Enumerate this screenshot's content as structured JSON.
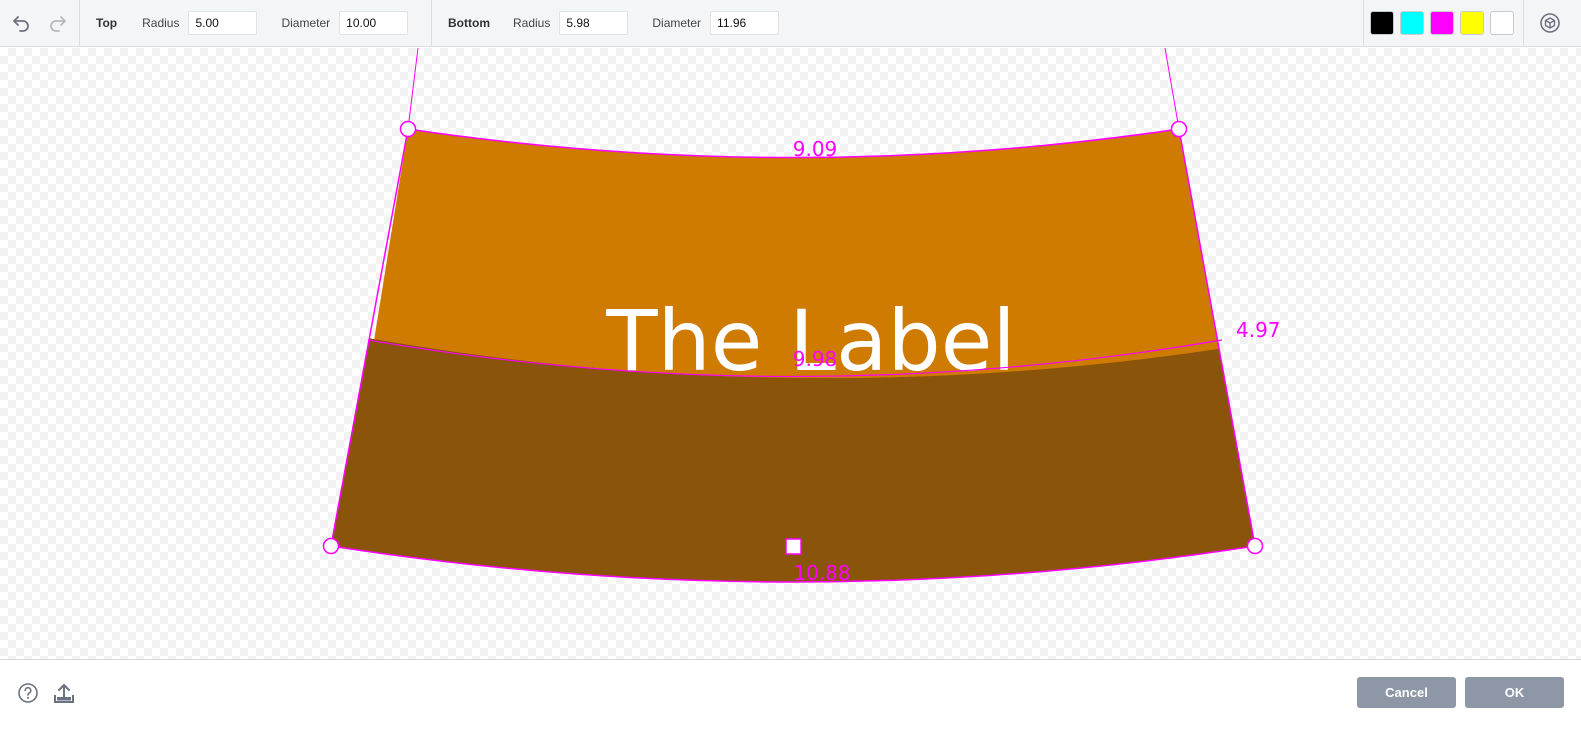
{
  "toolbar": {
    "undo_icon": "undo-icon",
    "redo_icon": "redo-icon",
    "top": {
      "title": "Top",
      "radius_label": "Radius",
      "radius_value": "5.00",
      "diameter_label": "Diameter",
      "diameter_value": "10.00"
    },
    "bottom": {
      "title": "Bottom",
      "radius_label": "Radius",
      "radius_value": "5.98",
      "diameter_label": "Diameter",
      "diameter_value": "11.96"
    },
    "swatches": [
      {
        "name": "black",
        "color": "#000000"
      },
      {
        "name": "cyan",
        "color": "#00ffff"
      },
      {
        "name": "magenta",
        "color": "#ff00ff"
      },
      {
        "name": "yellow",
        "color": "#ffff00"
      },
      {
        "name": "white",
        "color": "#ffffff"
      }
    ],
    "view3d_icon": "3d-view-icon"
  },
  "canvas": {
    "label_text": "The Label",
    "dimensions": {
      "top_width": "9.09",
      "middle_width": "9.98",
      "side_height": "4.97",
      "bottom_width": "10.88"
    },
    "colors": {
      "upper_band": "#cf7a00",
      "lower_band": "#8a550a",
      "guide": "#ff00ff"
    }
  },
  "footer": {
    "help_icon": "help-icon",
    "export_icon": "export-icon",
    "cancel_label": "Cancel",
    "ok_label": "OK"
  }
}
